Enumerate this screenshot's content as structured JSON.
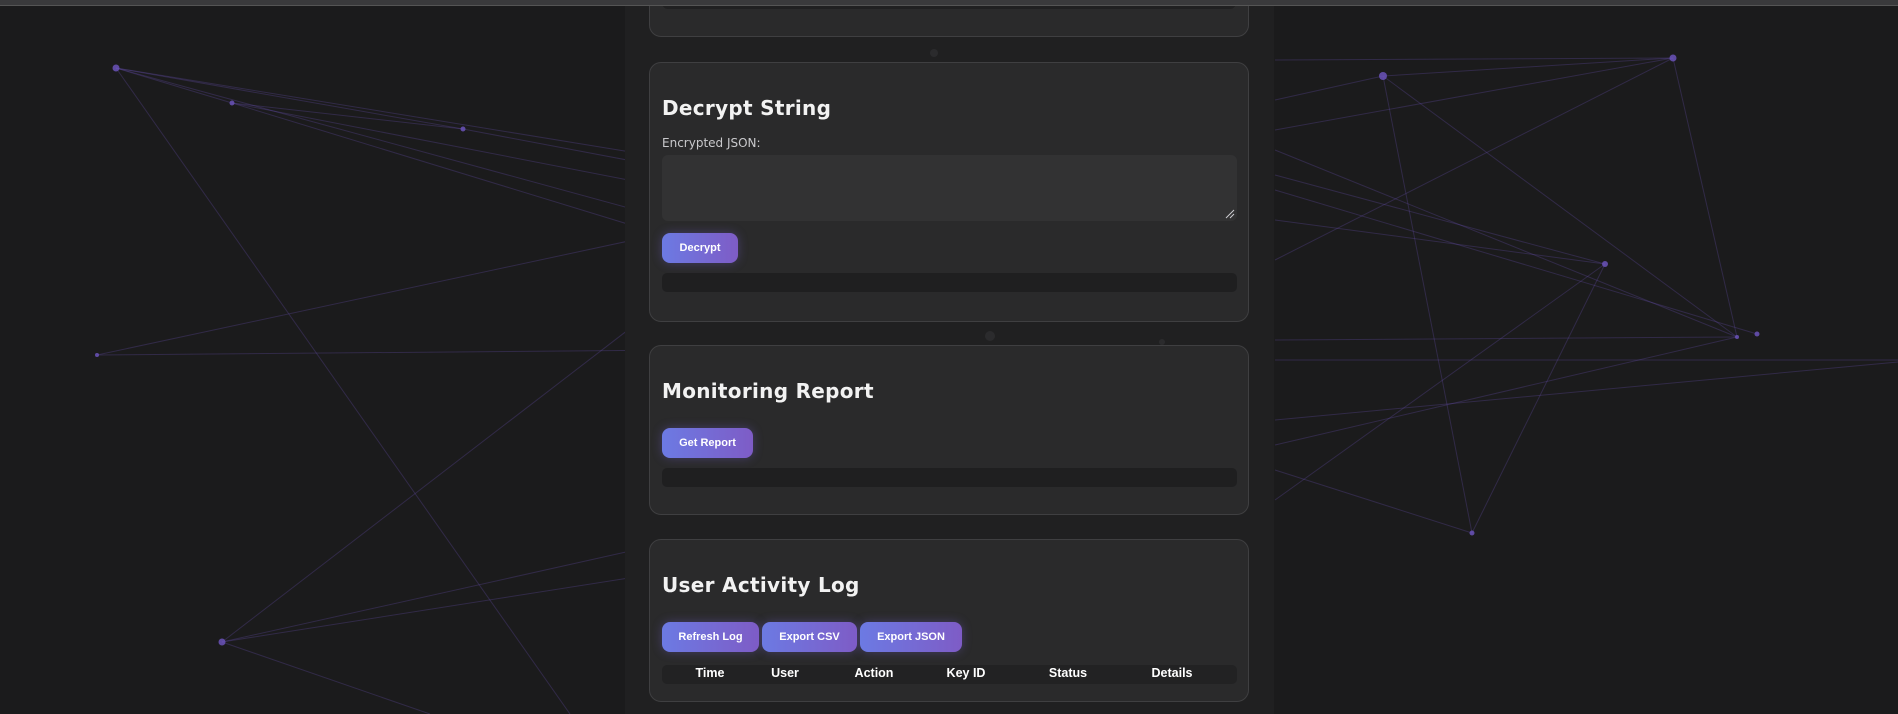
{
  "decrypt": {
    "title": "Decrypt String",
    "label": "Encrypted JSON:",
    "value": "",
    "button": "Decrypt"
  },
  "report": {
    "title": "Monitoring Report",
    "button": "Get Report"
  },
  "activity_log": {
    "title": "User Activity Log",
    "buttons": {
      "refresh": "Refresh Log",
      "export_csv": "Export CSV",
      "export_json": "Export JSON"
    },
    "columns": [
      "Time",
      "User",
      "Action",
      "Key ID",
      "Status",
      "Details"
    ]
  },
  "colors": {
    "page_background": "#1b1b1c",
    "column_background": "#202021",
    "card_background": "#2a2a2b",
    "button_gradient_start": "#6c7ae3",
    "button_gradient_end": "#7e5cc6",
    "network_line": "#7a5ccc"
  }
}
